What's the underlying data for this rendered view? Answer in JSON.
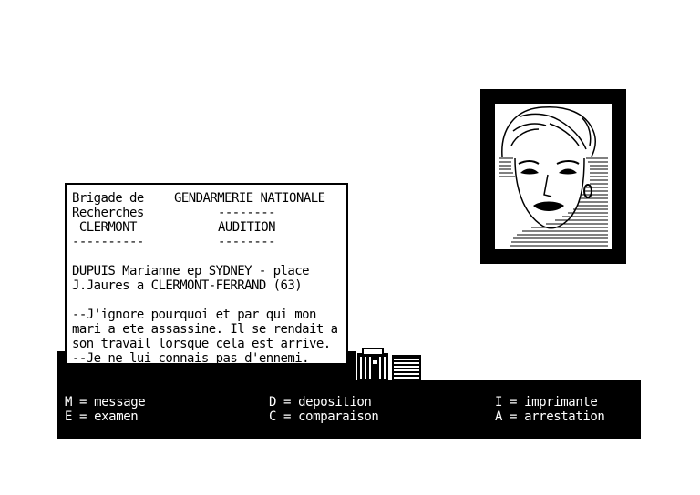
{
  "document": {
    "col1_line1": "Brigade de",
    "col1_line2": "Recherches",
    "col1_line3": " CLERMONT",
    "col1_line4": "----------",
    "col2_line1": "GENDARMERIE NATIONALE",
    "col2_line2": "--------",
    "col2_line3": "AUDITION",
    "col2_line4": "--------",
    "identity_line1": "DUPUIS Marianne ep SYDNEY - place",
    "identity_line2": "J.Jaures a CLERMONT-FERRAND (63)",
    "statement_line1": "--J'ignore pourquoi et par qui mon",
    "statement_line2": "mari a ete assassine. Il se rendait a",
    "statement_line3": "son travail lorsque cela est arrive.",
    "statement_line4": "--Je ne lui connais pas d'ennemi."
  },
  "menu": {
    "m": "M = message",
    "e": "E = examen",
    "d": "D = deposition",
    "c": "C = comparaison",
    "i": "I = imprimante",
    "a": "A = arrestation"
  },
  "portrait": {
    "icon": "woman-face-portrait"
  },
  "icons": {
    "archive": "archive-box-icon",
    "stack": "document-stack-icon"
  },
  "colors": {
    "background": "#ffffff",
    "ink": "#000000"
  }
}
